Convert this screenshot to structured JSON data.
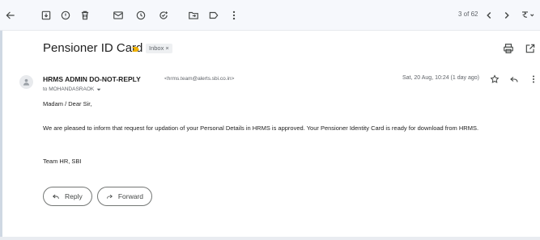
{
  "toolbar": {
    "items": [
      {
        "name": "back-arrow-icon",
        "label": "Back"
      },
      {
        "name": "archive-icon",
        "label": "Archive"
      },
      {
        "name": "report-spam-icon",
        "label": "Report spam"
      },
      {
        "name": "delete-icon",
        "label": "Delete"
      },
      {
        "name": "mark-unread-icon",
        "label": "Mark as unread"
      },
      {
        "name": "snooze-icon",
        "label": "Snooze"
      },
      {
        "name": "add-task-icon",
        "label": "Add to tasks"
      },
      {
        "name": "move-to-icon",
        "label": "Move to"
      },
      {
        "name": "labels-icon",
        "label": "Labels"
      },
      {
        "name": "more-vert-icon",
        "label": "More"
      }
    ],
    "page_counter": "3 of 62",
    "nav": {
      "prev": "Newer",
      "next": "Older"
    },
    "input_tools": "Input tools"
  },
  "email": {
    "subject": "Pensioner ID Card",
    "label_chip": "Inbox",
    "label_chip_close": "×",
    "sender_name": "HRMS ADMIN DO-NOT-REPLY",
    "sender_email": "<hrms.team@alerts.sbi.co.in>",
    "to_line": "to MOHANDASRAOK",
    "date": "Sat, 20 Aug, 10:24 (1 day ago)",
    "greeting": "Madam / Dear Sir,",
    "body": "We are pleased to inform that request for updation of your Personal Details in HRMS is approved. Your Pensioner Identity Card is ready for download from HRMS.",
    "signature": "Team HR, SBI"
  },
  "actions": {
    "reply_label": "Reply",
    "forward_label": "Forward"
  },
  "colors": {
    "toolbar_bg": "#f6f8fc",
    "important_marker": "#f2b200",
    "chip_bg": "#eef0f2",
    "text_primary": "#1f1f1f",
    "text_secondary": "#5f6368"
  }
}
